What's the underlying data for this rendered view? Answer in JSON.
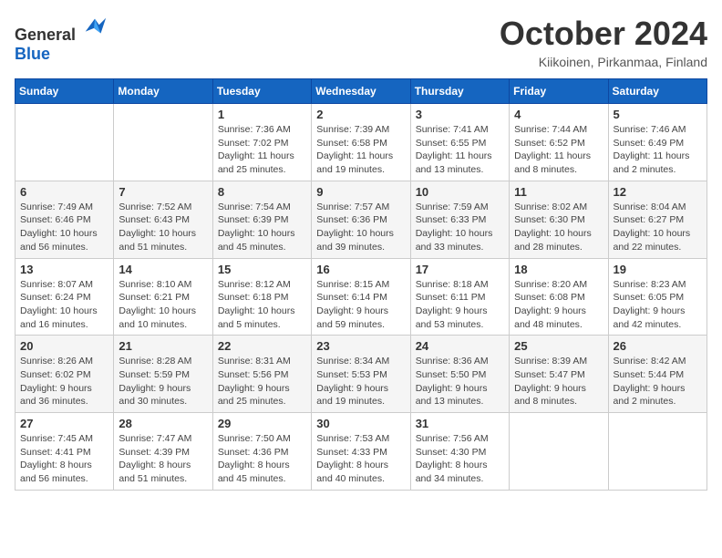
{
  "header": {
    "logo_general": "General",
    "logo_blue": "Blue",
    "month": "October 2024",
    "location": "Kiikoinen, Pirkanmaa, Finland"
  },
  "weekdays": [
    "Sunday",
    "Monday",
    "Tuesday",
    "Wednesday",
    "Thursday",
    "Friday",
    "Saturday"
  ],
  "weeks": [
    [
      {
        "day": "",
        "detail": ""
      },
      {
        "day": "",
        "detail": ""
      },
      {
        "day": "1",
        "detail": "Sunrise: 7:36 AM\nSunset: 7:02 PM\nDaylight: 11 hours\nand 25 minutes."
      },
      {
        "day": "2",
        "detail": "Sunrise: 7:39 AM\nSunset: 6:58 PM\nDaylight: 11 hours\nand 19 minutes."
      },
      {
        "day": "3",
        "detail": "Sunrise: 7:41 AM\nSunset: 6:55 PM\nDaylight: 11 hours\nand 13 minutes."
      },
      {
        "day": "4",
        "detail": "Sunrise: 7:44 AM\nSunset: 6:52 PM\nDaylight: 11 hours\nand 8 minutes."
      },
      {
        "day": "5",
        "detail": "Sunrise: 7:46 AM\nSunset: 6:49 PM\nDaylight: 11 hours\nand 2 minutes."
      }
    ],
    [
      {
        "day": "6",
        "detail": "Sunrise: 7:49 AM\nSunset: 6:46 PM\nDaylight: 10 hours\nand 56 minutes."
      },
      {
        "day": "7",
        "detail": "Sunrise: 7:52 AM\nSunset: 6:43 PM\nDaylight: 10 hours\nand 51 minutes."
      },
      {
        "day": "8",
        "detail": "Sunrise: 7:54 AM\nSunset: 6:39 PM\nDaylight: 10 hours\nand 45 minutes."
      },
      {
        "day": "9",
        "detail": "Sunrise: 7:57 AM\nSunset: 6:36 PM\nDaylight: 10 hours\nand 39 minutes."
      },
      {
        "day": "10",
        "detail": "Sunrise: 7:59 AM\nSunset: 6:33 PM\nDaylight: 10 hours\nand 33 minutes."
      },
      {
        "day": "11",
        "detail": "Sunrise: 8:02 AM\nSunset: 6:30 PM\nDaylight: 10 hours\nand 28 minutes."
      },
      {
        "day": "12",
        "detail": "Sunrise: 8:04 AM\nSunset: 6:27 PM\nDaylight: 10 hours\nand 22 minutes."
      }
    ],
    [
      {
        "day": "13",
        "detail": "Sunrise: 8:07 AM\nSunset: 6:24 PM\nDaylight: 10 hours\nand 16 minutes."
      },
      {
        "day": "14",
        "detail": "Sunrise: 8:10 AM\nSunset: 6:21 PM\nDaylight: 10 hours\nand 10 minutes."
      },
      {
        "day": "15",
        "detail": "Sunrise: 8:12 AM\nSunset: 6:18 PM\nDaylight: 10 hours\nand 5 minutes."
      },
      {
        "day": "16",
        "detail": "Sunrise: 8:15 AM\nSunset: 6:14 PM\nDaylight: 9 hours\nand 59 minutes."
      },
      {
        "day": "17",
        "detail": "Sunrise: 8:18 AM\nSunset: 6:11 PM\nDaylight: 9 hours\nand 53 minutes."
      },
      {
        "day": "18",
        "detail": "Sunrise: 8:20 AM\nSunset: 6:08 PM\nDaylight: 9 hours\nand 48 minutes."
      },
      {
        "day": "19",
        "detail": "Sunrise: 8:23 AM\nSunset: 6:05 PM\nDaylight: 9 hours\nand 42 minutes."
      }
    ],
    [
      {
        "day": "20",
        "detail": "Sunrise: 8:26 AM\nSunset: 6:02 PM\nDaylight: 9 hours\nand 36 minutes."
      },
      {
        "day": "21",
        "detail": "Sunrise: 8:28 AM\nSunset: 5:59 PM\nDaylight: 9 hours\nand 30 minutes."
      },
      {
        "day": "22",
        "detail": "Sunrise: 8:31 AM\nSunset: 5:56 PM\nDaylight: 9 hours\nand 25 minutes."
      },
      {
        "day": "23",
        "detail": "Sunrise: 8:34 AM\nSunset: 5:53 PM\nDaylight: 9 hours\nand 19 minutes."
      },
      {
        "day": "24",
        "detail": "Sunrise: 8:36 AM\nSunset: 5:50 PM\nDaylight: 9 hours\nand 13 minutes."
      },
      {
        "day": "25",
        "detail": "Sunrise: 8:39 AM\nSunset: 5:47 PM\nDaylight: 9 hours\nand 8 minutes."
      },
      {
        "day": "26",
        "detail": "Sunrise: 8:42 AM\nSunset: 5:44 PM\nDaylight: 9 hours\nand 2 minutes."
      }
    ],
    [
      {
        "day": "27",
        "detail": "Sunrise: 7:45 AM\nSunset: 4:41 PM\nDaylight: 8 hours\nand 56 minutes."
      },
      {
        "day": "28",
        "detail": "Sunrise: 7:47 AM\nSunset: 4:39 PM\nDaylight: 8 hours\nand 51 minutes."
      },
      {
        "day": "29",
        "detail": "Sunrise: 7:50 AM\nSunset: 4:36 PM\nDaylight: 8 hours\nand 45 minutes."
      },
      {
        "day": "30",
        "detail": "Sunrise: 7:53 AM\nSunset: 4:33 PM\nDaylight: 8 hours\nand 40 minutes."
      },
      {
        "day": "31",
        "detail": "Sunrise: 7:56 AM\nSunset: 4:30 PM\nDaylight: 8 hours\nand 34 minutes."
      },
      {
        "day": "",
        "detail": ""
      },
      {
        "day": "",
        "detail": ""
      }
    ]
  ]
}
